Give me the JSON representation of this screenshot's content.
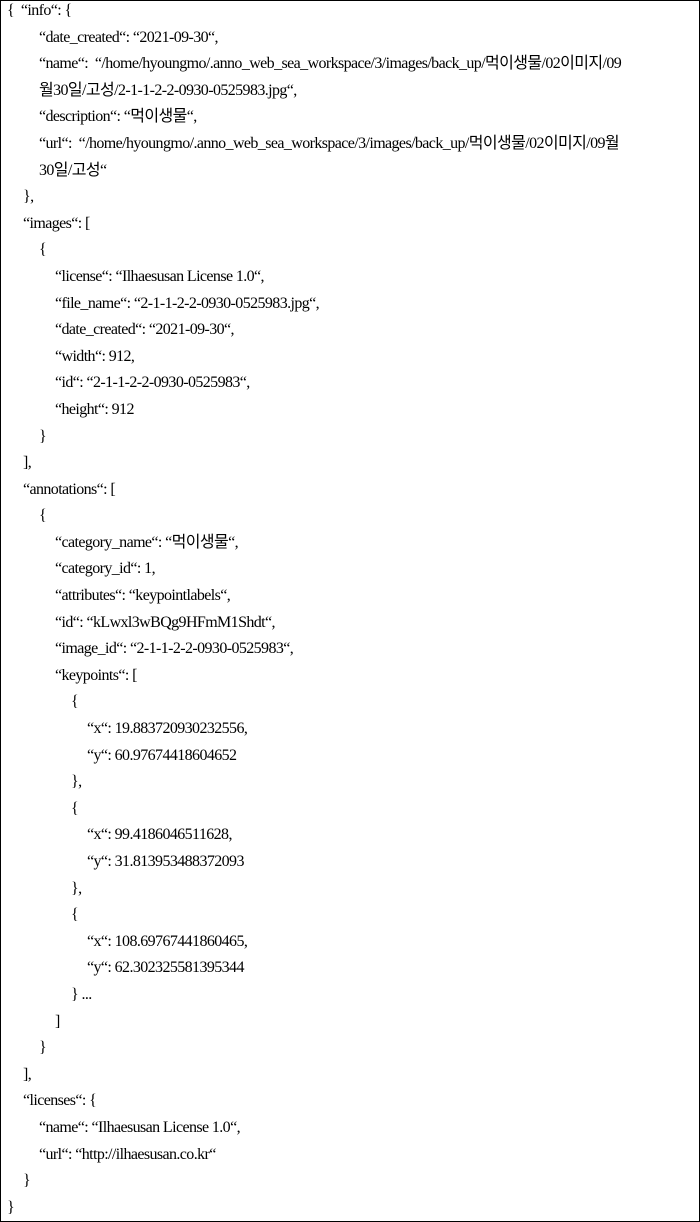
{
  "document": {
    "lines": [
      {
        "indent": 0,
        "text": "{  “info“: {"
      },
      {
        "indent": 2,
        "text": "“date_created“: “2021-09-30“,"
      },
      {
        "indent": 2,
        "text": "“name“:  “/home/hyoungmo/.anno_web_sea_workspace/3/images/back_up/먹이생물/02이미지/09"
      },
      {
        "indent": 2,
        "text": "월30일/고성/2-1-1-2-2-0930-0525983.jpg“,"
      },
      {
        "indent": 2,
        "text": "“description“: “먹이생물“,"
      },
      {
        "indent": 2,
        "text": "“url“:  “/home/hyoungmo/.anno_web_sea_workspace/3/images/back_up/먹이생물/02이미지/09월"
      },
      {
        "indent": 2,
        "text": "30일/고성“"
      },
      {
        "indent": 1,
        "text": "},"
      },
      {
        "indent": 1,
        "text": "“images“: ["
      },
      {
        "indent": 2,
        "text": "{"
      },
      {
        "indent": 3,
        "text": "“license“: “Ilhaesusan License 1.0“,"
      },
      {
        "indent": 3,
        "text": "“file_name“: “2-1-1-2-2-0930-0525983.jpg“,"
      },
      {
        "indent": 3,
        "text": "“date_created“: “2021-09-30“,"
      },
      {
        "indent": 3,
        "text": "“width“: 912,"
      },
      {
        "indent": 3,
        "text": "“id“: “2-1-1-2-2-0930-0525983“,"
      },
      {
        "indent": 3,
        "text": "“height“: 912"
      },
      {
        "indent": 2,
        "text": "}"
      },
      {
        "indent": 1,
        "text": "],"
      },
      {
        "indent": 1,
        "text": "“annotations“: ["
      },
      {
        "indent": 2,
        "text": "{"
      },
      {
        "indent": 3,
        "text": "“category_name“: “먹이생물“,"
      },
      {
        "indent": 3,
        "text": "“category_id“: 1,"
      },
      {
        "indent": 3,
        "text": "“attributes“: “keypointlabels“,"
      },
      {
        "indent": 3,
        "text": "“id“: “kLwxl3wBQg9HFmM1Shdt“,"
      },
      {
        "indent": 3,
        "text": "“image_id“: “2-1-1-2-2-0930-0525983“,"
      },
      {
        "indent": 3,
        "text": "“keypoints“: ["
      },
      {
        "indent": 4,
        "text": "{"
      },
      {
        "indent": 5,
        "text": "“x“: 19.883720930232556,"
      },
      {
        "indent": 5,
        "text": "“y“: 60.97674418604652"
      },
      {
        "indent": 4,
        "text": "},"
      },
      {
        "indent": 4,
        "text": "{"
      },
      {
        "indent": 5,
        "text": "“x“: 99.4186046511628,"
      },
      {
        "indent": 5,
        "text": "“y“: 31.813953488372093"
      },
      {
        "indent": 4,
        "text": "},"
      },
      {
        "indent": 4,
        "text": "{"
      },
      {
        "indent": 5,
        "text": "“x“: 108.69767441860465,"
      },
      {
        "indent": 5,
        "text": "“y“: 62.302325581395344"
      },
      {
        "indent": 4,
        "text": "} ..."
      },
      {
        "indent": 3,
        "text": "]"
      },
      {
        "indent": 2,
        "text": "}"
      },
      {
        "indent": 1,
        "text": "],"
      },
      {
        "indent": 1,
        "text": "“licenses“: {"
      },
      {
        "indent": 2,
        "text": "“name“: “Ilhaesusan License 1.0“,"
      },
      {
        "indent": 2,
        "text": "“url“: “http://ilhaesusan.co.kr“"
      },
      {
        "indent": 1,
        "text": "}"
      },
      {
        "indent": 0,
        "text": "}"
      }
    ]
  }
}
